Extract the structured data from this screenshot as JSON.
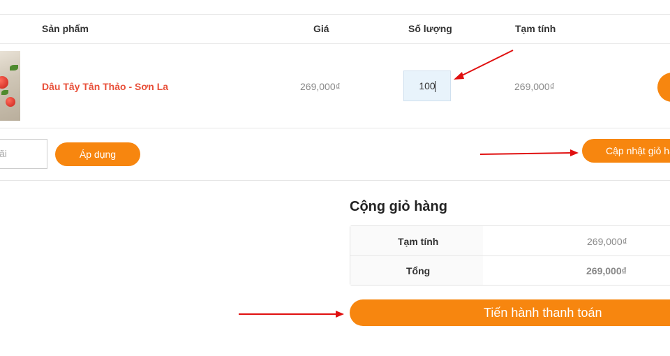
{
  "table": {
    "headers": {
      "product": "Sản phẩm",
      "price": "Giá",
      "quantity": "Số lượng",
      "subtotal": "Tạm tính"
    },
    "row": {
      "name": "Dâu Tây Tân Thảo - Sơn La",
      "price": "269,000₫",
      "quantity": "100",
      "subtotal": "269,000₫"
    }
  },
  "coupon": {
    "placeholder": "ãi",
    "apply_label": "Áp dụng"
  },
  "update_cart_label": "Cập nhật giỏ hàng",
  "totals": {
    "title": "Cộng giỏ hàng",
    "rows": [
      {
        "label": "Tạm tính",
        "value": "269,000₫"
      },
      {
        "label": "Tổng",
        "value": "269,000₫"
      }
    ]
  },
  "checkout_label": "Tiến hành thanh toán",
  "colors": {
    "accent": "#f7860f",
    "product_name": "#e8503a",
    "annotation_arrow": "#e01010"
  },
  "icons": {
    "thumbnail": "strawberry-product-image"
  }
}
